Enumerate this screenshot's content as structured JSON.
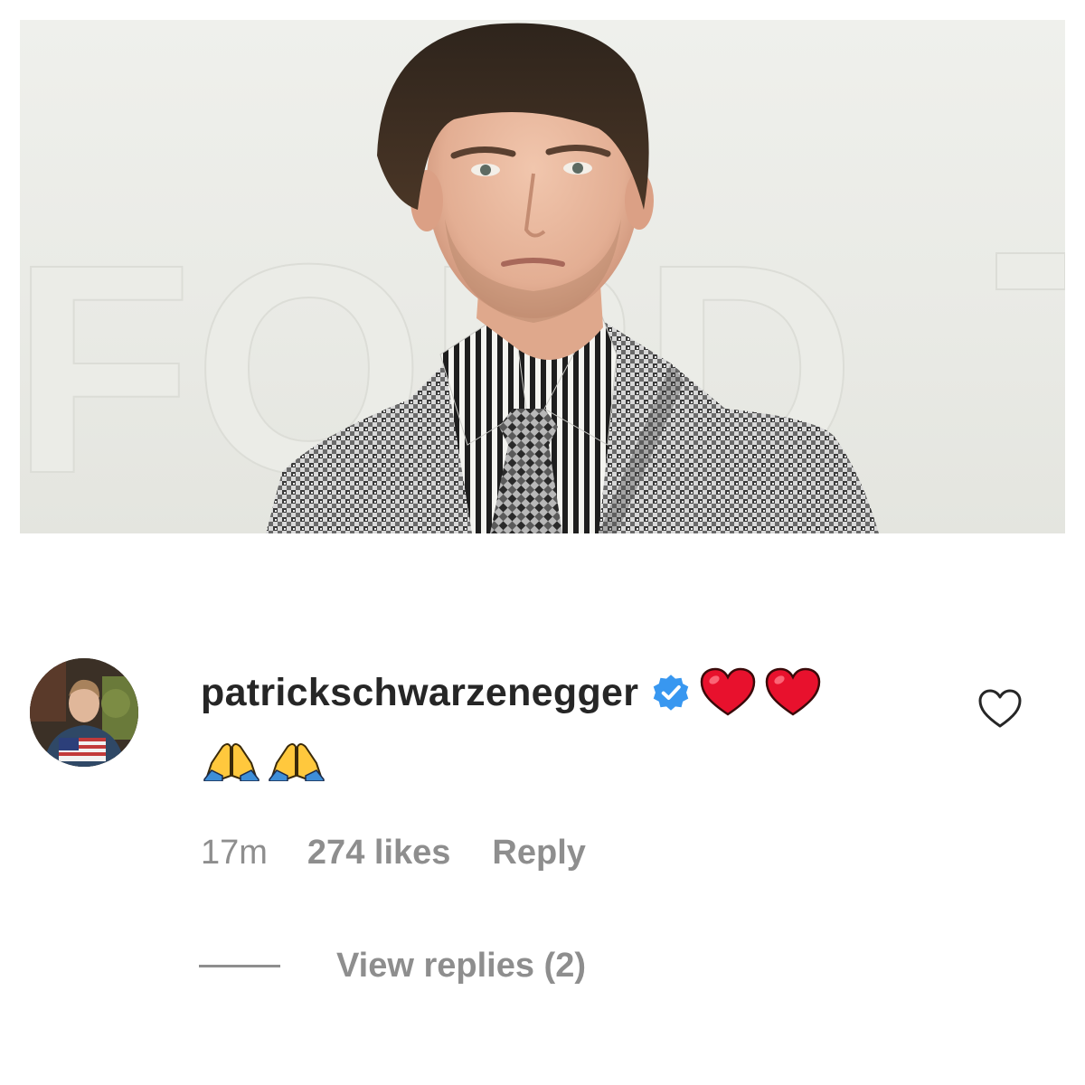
{
  "post": {
    "photo_icon": "portrait-photo",
    "backdrop_text": "FORD"
  },
  "comment": {
    "avatar_icon": "avatar-photo",
    "username": "patrickschwarzenegger",
    "verified_icon": "verified-badge-icon",
    "emojis_line1": [
      "red-heart-emoji",
      "red-heart-emoji"
    ],
    "emojis_line2": [
      "folded-hands-emoji",
      "folded-hands-emoji"
    ],
    "timestamp": "17m",
    "likes": "274 likes",
    "reply_label": "Reply",
    "view_replies_label": "View replies (2)",
    "like_icon": "heart-outline-icon"
  },
  "colors": {
    "username": "#262626",
    "meta": "#8e8e8e",
    "verified": "#3897f0",
    "heart_emoji": "#e8112d"
  }
}
